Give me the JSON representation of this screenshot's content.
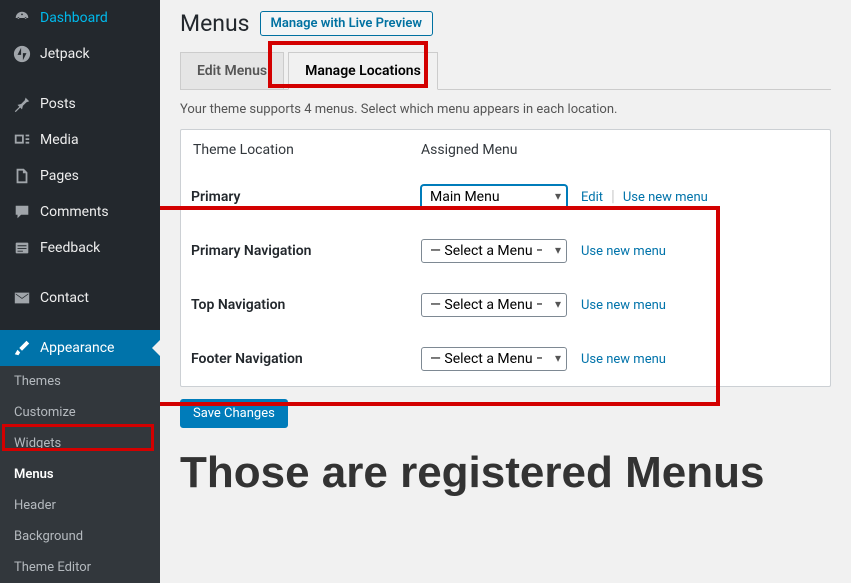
{
  "sidebar": {
    "items": [
      {
        "label": "Dashboard",
        "icon": "⌂"
      },
      {
        "label": "Jetpack",
        "icon": "◉"
      },
      {
        "label": "Posts",
        "icon": "✎"
      },
      {
        "label": "Media",
        "icon": "⧉"
      },
      {
        "label": "Pages",
        "icon": "▤"
      },
      {
        "label": "Comments",
        "icon": "💬"
      },
      {
        "label": "Feedback",
        "icon": "☰"
      },
      {
        "label": "Contact",
        "icon": "✉"
      },
      {
        "label": "Appearance",
        "icon": "✦"
      }
    ],
    "submenu": [
      {
        "label": "Themes"
      },
      {
        "label": "Customize"
      },
      {
        "label": "Widgets"
      },
      {
        "label": "Menus"
      },
      {
        "label": "Header"
      },
      {
        "label": "Background"
      },
      {
        "label": "Theme Editor"
      }
    ]
  },
  "page": {
    "title": "Menus",
    "preview_button": "Manage with Live Preview",
    "tabs": [
      {
        "label": "Edit Menus"
      },
      {
        "label": "Manage Locations"
      }
    ],
    "description": "Your theme supports 4 menus. Select which menu appears in each location.",
    "table": {
      "col1": "Theme Location",
      "col2": "Assigned Menu",
      "rows": [
        {
          "name": "Primary",
          "selected": "Main Menu",
          "edit": "Edit",
          "new": "Use new menu"
        },
        {
          "name": "Primary Navigation",
          "selected": "— Select a Menu —",
          "new": "Use new menu"
        },
        {
          "name": "Top Navigation",
          "selected": "— Select a Menu —",
          "new": "Use new menu"
        },
        {
          "name": "Footer Navigation",
          "selected": "— Select a Menu —",
          "new": "Use new menu"
        }
      ]
    },
    "save_button": "Save Changes",
    "annotation": "Those are registered Menus"
  }
}
